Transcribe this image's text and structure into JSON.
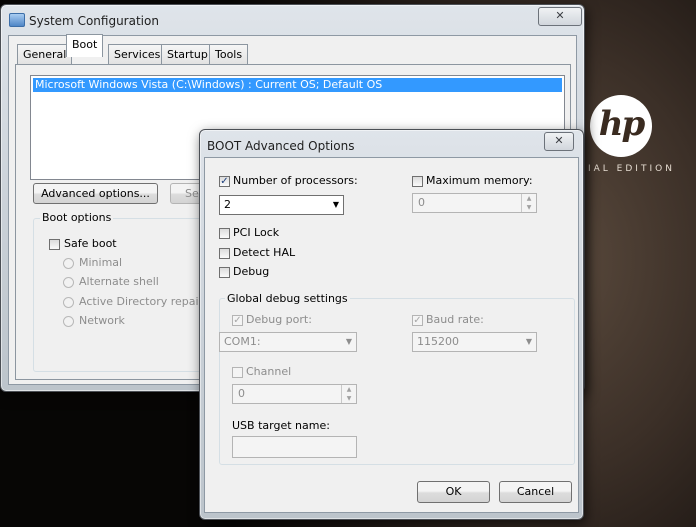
{
  "desktop": {
    "brand_logo": "hp",
    "brand_edition": "IAL EDITION"
  },
  "syscfg": {
    "title": "System Configuration",
    "close_glyph": "✕",
    "tabs": [
      "General",
      "Boot",
      "Services",
      "Startup",
      "Tools"
    ],
    "active_tab": "Boot",
    "os_entry": "Microsoft Windows Vista (C:\\Windows) : Current OS; Default OS",
    "advanced_button": "Advanced options...",
    "set_default_button": "Se",
    "boot_options_label": "Boot options",
    "safe_boot_label": "Safe boot",
    "safe_boot_checked": false,
    "radio_options": [
      "Minimal",
      "Alternate shell",
      "Active Directory repair",
      "Network"
    ]
  },
  "advanced": {
    "title": "BOOT Advanced Options",
    "close_glyph": "✕",
    "num_processors_label": "Number of processors:",
    "num_processors_checked": true,
    "num_processors_value": "2",
    "max_memory_label": "Maximum memory:",
    "max_memory_checked": false,
    "max_memory_value": "0",
    "pci_lock_label": "PCI Lock",
    "detect_hal_label": "Detect HAL",
    "debug_label": "Debug",
    "global_debug_label": "Global debug settings",
    "debug_port_label": "Debug port:",
    "debug_port_value": "COM1:",
    "baud_rate_label": "Baud rate:",
    "baud_rate_value": "115200",
    "channel_label": "Channel",
    "channel_value": "0",
    "usb_target_label": "USB target name:",
    "usb_target_value": "",
    "ok_button": "OK",
    "cancel_button": "Cancel"
  },
  "colors": {
    "selection": "#3399ff",
    "selection_text": "#ffffff"
  }
}
